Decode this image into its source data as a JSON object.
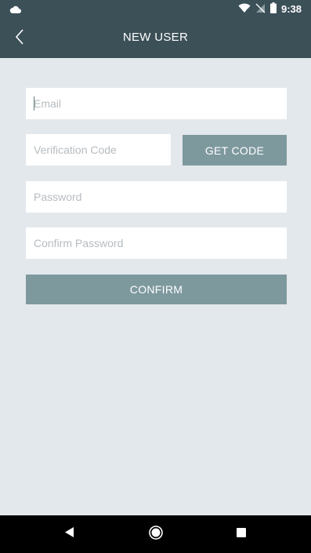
{
  "status_bar": {
    "time": "9:38"
  },
  "app_bar": {
    "title": "NEW USER"
  },
  "form": {
    "email": {
      "placeholder": "Email",
      "value": ""
    },
    "verification_code": {
      "placeholder": "Verification Code",
      "value": ""
    },
    "get_code_label": "GET CODE",
    "password": {
      "placeholder": "Password",
      "value": ""
    },
    "confirm_password": {
      "placeholder": "Confirm Password",
      "value": ""
    },
    "confirm_label": "CONFIRM"
  },
  "colors": {
    "bar": "#3c5058",
    "background": "#e3e8ec",
    "button": "#7d999e",
    "nav": "#000000"
  },
  "icons": {
    "status_left": "cloud-icon",
    "status_right": [
      "wifi-icon",
      "no-signal-icon",
      "battery-icon"
    ],
    "back": "chevron-left-icon",
    "nav": [
      "back-triangle-icon",
      "home-circle-icon",
      "recents-square-icon"
    ]
  }
}
